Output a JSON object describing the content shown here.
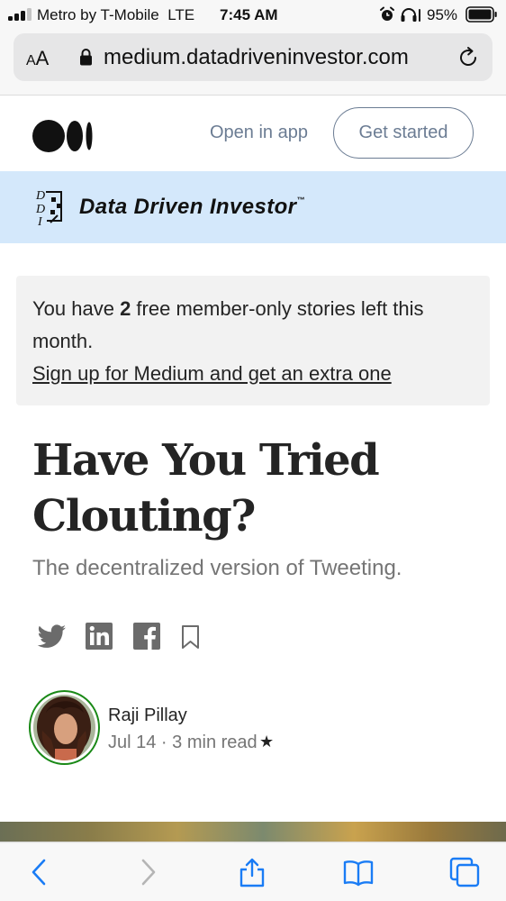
{
  "status_bar": {
    "carrier": "Metro by T-Mobile",
    "network": "LTE",
    "time": "7:45 AM",
    "battery": "95%",
    "battery_level": 0.95,
    "signal_bars": 3,
    "icons": [
      "signal-icon",
      "alarm-icon",
      "headphone-icon",
      "battery-icon"
    ]
  },
  "browser": {
    "text_size_label": "AA",
    "url": "medium.datadriveninvestor.com",
    "icons": [
      "lock-icon",
      "reload-icon"
    ]
  },
  "medium_header": {
    "logo": "medium-logo",
    "open_in_app": "Open in app",
    "get_started": "Get started"
  },
  "publication": {
    "name": "Data Driven Investor",
    "trademark": "™",
    "logo_letters": "DDI"
  },
  "member_notice": {
    "prefix": "You have ",
    "count": "2",
    "suffix": " free member-only stories left this",
    "line2": "month.",
    "link": "Sign up for Medium and get an extra one"
  },
  "article": {
    "title": "Have You Tried Clouting?",
    "subtitle": "The decentralized version of Tweeting.",
    "share_icons": [
      "twitter-icon",
      "linkedin-icon",
      "facebook-icon",
      "bookmark-icon"
    ]
  },
  "author": {
    "name": "Raji Pillay",
    "date": "Jul 14",
    "read_time": "3 min read",
    "separator": " · ",
    "member_star": "★"
  },
  "toolbar": {
    "buttons": [
      "back-icon",
      "forward-icon",
      "share-icon",
      "bookmarks-icon",
      "tabs-icon"
    ]
  },
  "colors": {
    "banner_bg": "#d4e8fb",
    "muted_text": "#6b7c93",
    "avatar_ring": "#1a8917",
    "ios_blue": "#1a7cf5"
  }
}
